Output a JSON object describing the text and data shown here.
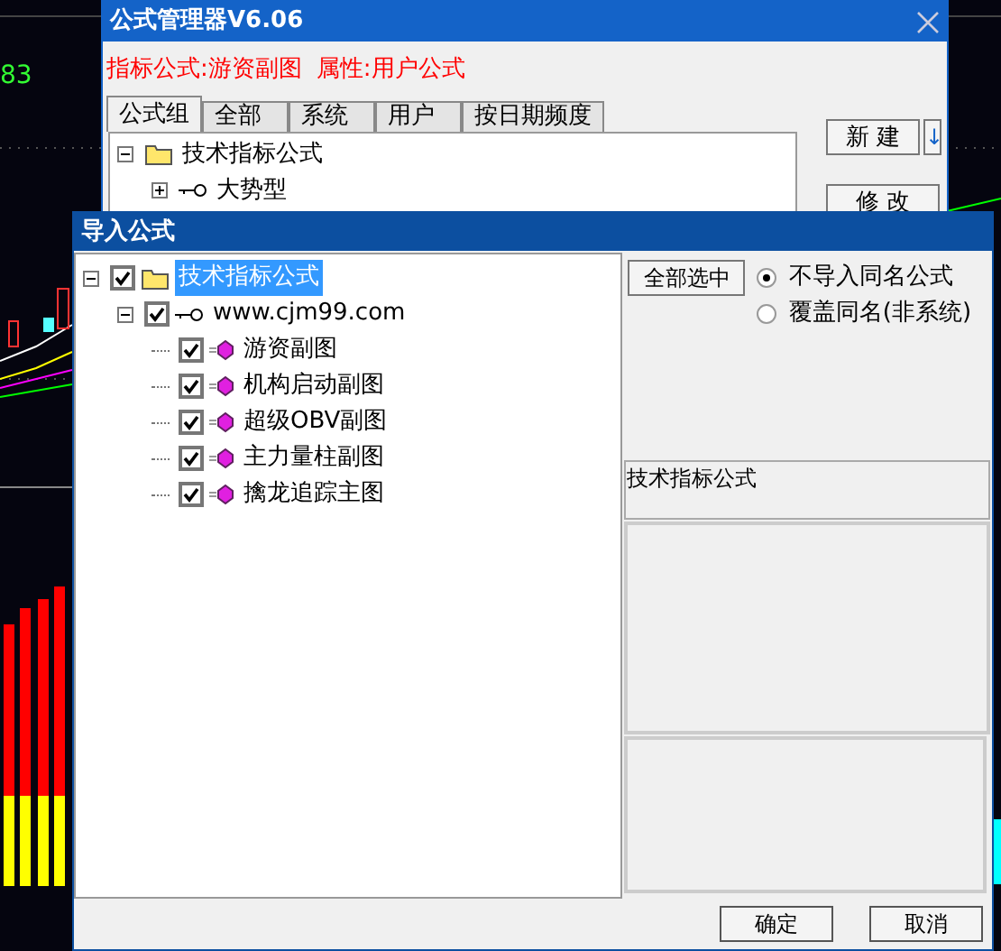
{
  "background": {
    "reading": "83"
  },
  "manager": {
    "title": "公式管理器V6.06",
    "formula": "指标公式:游资副图",
    "attribute": "属性:用户公式",
    "tabs": [
      {
        "label": "公式组",
        "selected": true
      },
      {
        "label": "全部",
        "selected": false
      },
      {
        "label": "系统",
        "selected": false
      },
      {
        "label": "用户",
        "selected": false
      },
      {
        "label": "按日期频度",
        "selected": false
      }
    ],
    "tree": [
      {
        "label": "技术指标公式",
        "kind": "folder",
        "expanded": true,
        "children": [
          {
            "label": "大势型",
            "kind": "key",
            "expanded": false
          }
        ]
      }
    ],
    "buttons": [
      {
        "label": "新 建"
      },
      {
        "label": "↓"
      },
      {
        "label": "修 改"
      }
    ]
  },
  "import": {
    "title": "导入公式",
    "tree": [
      {
        "label": "技术指标公式",
        "kind": "folder",
        "checked": true,
        "selected": true,
        "expanded": true,
        "children": [
          {
            "label": "www.cjm99.com",
            "kind": "key",
            "checked": true,
            "selected": false,
            "expanded": true,
            "children": [
              {
                "label": "游资副图",
                "kind": "formula",
                "checked": true,
                "selected": false
              },
              {
                "label": "机构启动副图",
                "kind": "formula",
                "checked": true,
                "selected": false
              },
              {
                "label": "超级OBV副图",
                "kind": "formula",
                "checked": true,
                "selected": false
              },
              {
                "label": "主力量柱副图",
                "kind": "formula",
                "checked": true,
                "selected": false
              },
              {
                "label": "擒龙追踪主图",
                "kind": "formula",
                "checked": true,
                "selected": false
              }
            ]
          }
        ]
      }
    ],
    "select_all": "全部选中",
    "options": [
      {
        "label": "不导入同名公式",
        "selected": true
      },
      {
        "label": "覆盖同名(非系统)",
        "selected": false
      }
    ],
    "group_name": "技术指标公式",
    "buttons": [
      {
        "label": "确定"
      },
      {
        "label": "取消"
      }
    ]
  }
}
